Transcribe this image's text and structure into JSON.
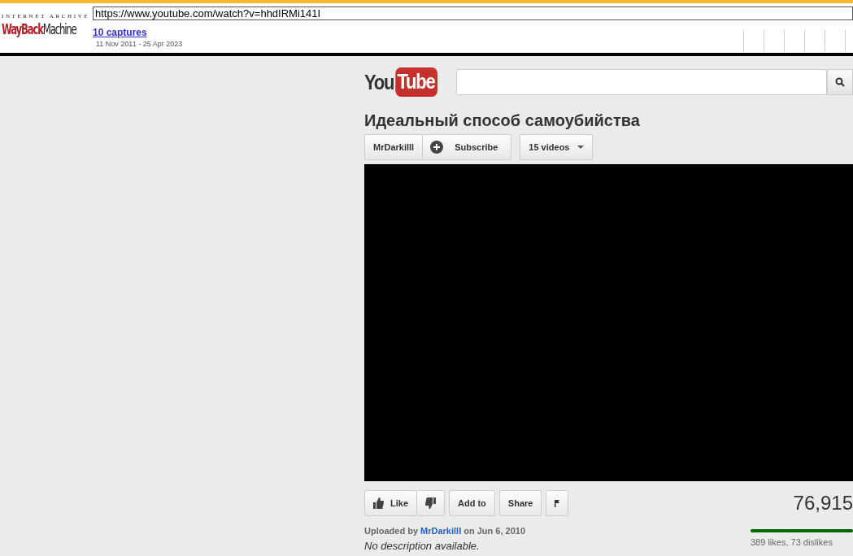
{
  "wayback": {
    "logo_top": "INTERNET ARCHIVE",
    "logo_red": "WayBack",
    "logo_dark": "Machine",
    "url": "https://www.youtube.com/watch?v=hhdIRMi141I",
    "captures": "10 captures",
    "date_range": "11 Nov 2011 - 25 Apr 2023"
  },
  "header": {
    "logo_you": "You",
    "logo_tube": "Tube"
  },
  "video": {
    "title": "Идеальный способ самоубийства",
    "channel": "MrDarkilll",
    "subscribe": "Subscribe",
    "videos": "15 videos"
  },
  "actions": {
    "like": "Like",
    "add_to": "Add to",
    "share": "Share"
  },
  "views": "76,915",
  "uploaded": {
    "prefix": "Uploaded by",
    "user": "MrDarkilll",
    "suffix": "on Jun 6, 2010"
  },
  "description": "No description available.",
  "ratings": {
    "level": 0.84,
    "text": "389 likes, 73 dislikes"
  }
}
